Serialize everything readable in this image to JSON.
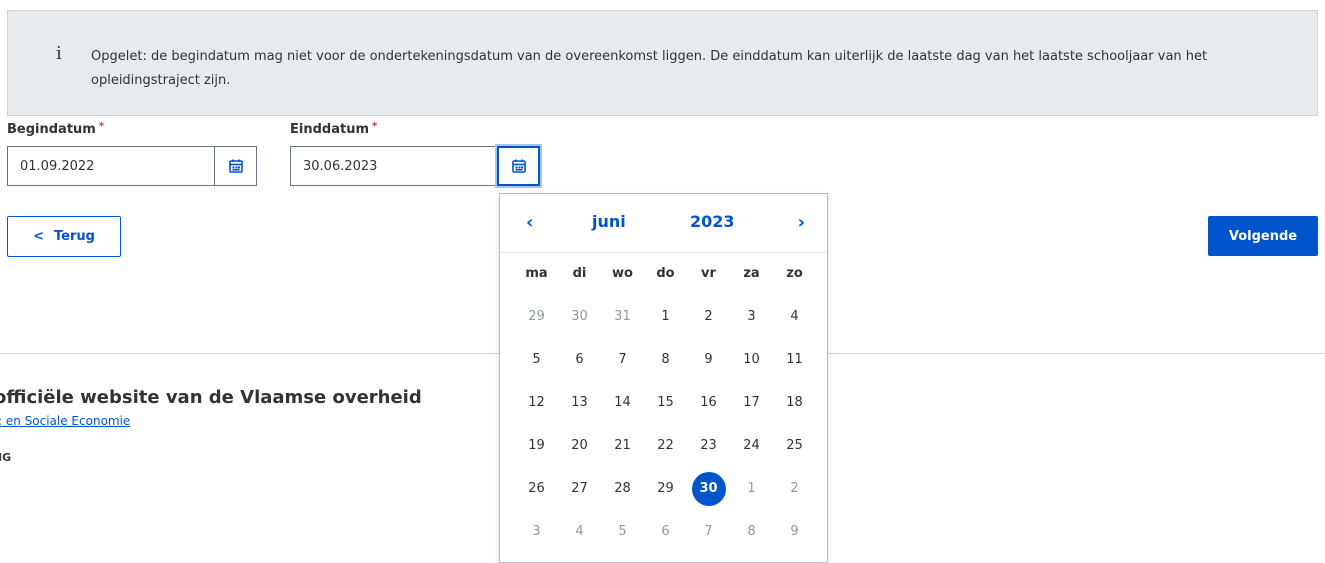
{
  "notice": {
    "icon": "info-icon",
    "text": "Opgelet: de begindatum mag niet voor de ondertekeningsdatum van de overeenkomst liggen. De einddatum kan uiterlijk de laatste dag van het laatste schooljaar van het opleidingstraject zijn."
  },
  "begin": {
    "label": "Begindatum",
    "required_mark": "*",
    "value": "01.09.2022"
  },
  "end": {
    "label": "Einddatum",
    "required_mark": "*",
    "value": "30.06.2023"
  },
  "buttons": {
    "back_icon": "<",
    "back_label": "Terug",
    "next_label": "Volgende"
  },
  "footer": {
    "title": "officiële website van de Vlaamse overheid",
    "link": ": en Sociale Economie",
    "small": "IG"
  },
  "datepicker": {
    "prev": "‹",
    "next": "›",
    "month": "juni",
    "year": "2023",
    "weekdays": [
      "ma",
      "di",
      "wo",
      "do",
      "vr",
      "za",
      "zo"
    ],
    "days": [
      {
        "d": "29",
        "m": true
      },
      {
        "d": "30",
        "m": true
      },
      {
        "d": "31",
        "m": true
      },
      {
        "d": "1"
      },
      {
        "d": "2"
      },
      {
        "d": "3"
      },
      {
        "d": "4"
      },
      {
        "d": "5"
      },
      {
        "d": "6"
      },
      {
        "d": "7"
      },
      {
        "d": "8"
      },
      {
        "d": "9"
      },
      {
        "d": "10"
      },
      {
        "d": "11"
      },
      {
        "d": "12"
      },
      {
        "d": "13"
      },
      {
        "d": "14"
      },
      {
        "d": "15"
      },
      {
        "d": "16"
      },
      {
        "d": "17"
      },
      {
        "d": "18"
      },
      {
        "d": "19"
      },
      {
        "d": "20"
      },
      {
        "d": "21"
      },
      {
        "d": "22"
      },
      {
        "d": "23"
      },
      {
        "d": "24"
      },
      {
        "d": "25"
      },
      {
        "d": "26"
      },
      {
        "d": "27"
      },
      {
        "d": "28"
      },
      {
        "d": "29"
      },
      {
        "d": "30",
        "s": true
      },
      {
        "d": "1",
        "m": true
      },
      {
        "d": "2",
        "m": true
      },
      {
        "d": "3",
        "m": true
      },
      {
        "d": "4",
        "m": true
      },
      {
        "d": "5",
        "m": true
      },
      {
        "d": "6",
        "m": true
      },
      {
        "d": "7",
        "m": true
      },
      {
        "d": "8",
        "m": true
      },
      {
        "d": "9",
        "m": true
      }
    ]
  },
  "colors": {
    "accent": "#0055cc",
    "required": "#d2373c",
    "notice_bg": "#e8ebee"
  }
}
